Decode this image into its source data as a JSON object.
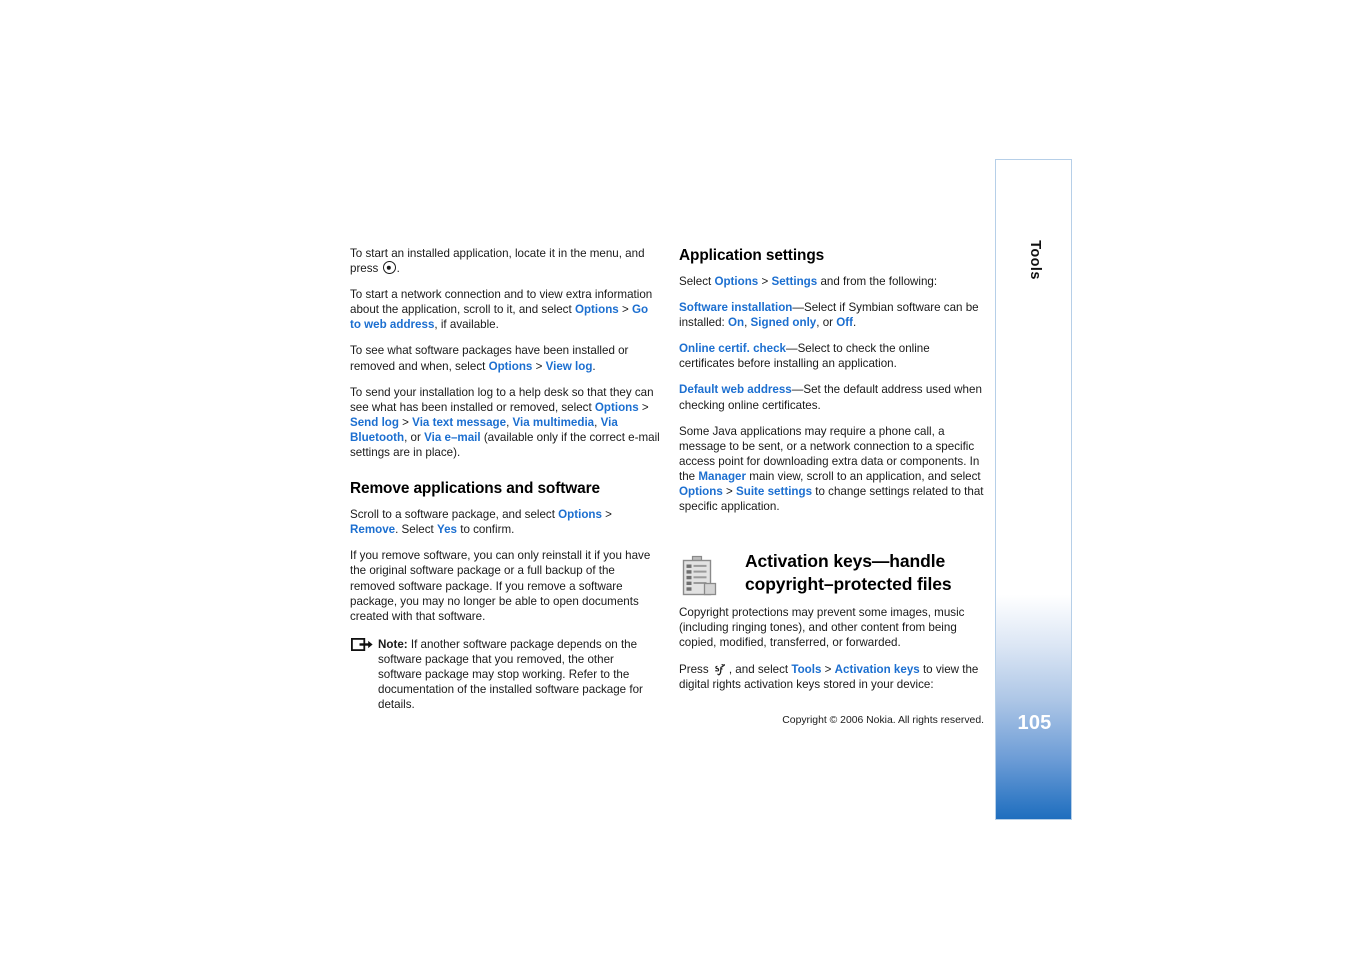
{
  "document": {
    "title": "Nokia device user guide page",
    "page_number": "105",
    "section_tab_label": "Tools",
    "copyright": "Copyright © 2006 Nokia. All rights reserved."
  },
  "colors": {
    "link": "#1c6fd0",
    "tab_gradient_end": "#1f6ebe",
    "tab_border": "#b6cfe8",
    "text": "#1a1a1a"
  },
  "left_column": {
    "p1_a": "To start an installed application, locate it in the menu, and press ",
    "p1_b": ".",
    "p2_a": "To start a network connection and to view extra information about the application, scroll to it, and select ",
    "p2_link1": "Options",
    "p2_sep": " > ",
    "p2_link2": "Go to web address",
    "p2_b": ", if available.",
    "p3_a": "To see what software packages have been installed or removed and when, select ",
    "p3_link1": "Options",
    "p3_sep": " > ",
    "p3_link2": "View log",
    "p3_b": ".",
    "p4_a": "To send your installation log to a help desk so that they can see what has been installed or removed, select ",
    "p4_link1": "Options",
    "p4_sep1": " > ",
    "p4_link2": "Send log",
    "p4_sep2": " > ",
    "p4_link3": "Via text message",
    "p4_c1": ", ",
    "p4_link4": "Via multimedia",
    "p4_c2": ", ",
    "p4_link5": "Via Bluetooth",
    "p4_c3": ", or ",
    "p4_link6": "Via e–mail",
    "p4_b": " (available only if the correct e-mail settings are in place).",
    "heading": "Remove applications and software",
    "p5_a": "Scroll to a software package, and select ",
    "p5_link1": "Options",
    "p5_sep": " > ",
    "p5_link2": "Remove",
    "p5_mid": ". Select ",
    "p5_link3": "Yes",
    "p5_b": " to confirm.",
    "p6": "If you remove software, you can only reinstall it if you have the original software package or a full backup of the removed software package. If you remove a software package, you may no longer be able to open documents created with that software.",
    "note_label": "Note:",
    "note_body": " If another software package depends on the software package that you removed, the other software package may stop working. Refer to the documentation of the installed software package for details."
  },
  "right_column": {
    "heading1": "Application settings",
    "r1_a": "Select ",
    "r1_link1": "Options",
    "r1_sep": " > ",
    "r1_link2": "Settings",
    "r1_b": " and from the following:",
    "r2_link1": "Software installation",
    "r2_a": "—Select if Symbian software can be installed: ",
    "r2_link2": "On",
    "r2_c1": ", ",
    "r2_link3": "Signed only",
    "r2_c2": ", or ",
    "r2_link4": "Off",
    "r2_b": ".",
    "r3_link1": "Online certif. check",
    "r3_a": "—Select to check the online certificates before installing an application.",
    "r4_link1": "Default web address",
    "r4_a": "—Set the default address used when checking online certificates.",
    "r5_a": "Some Java applications may require a phone call, a message to be sent, or a network connection to a specific access point for downloading extra data or components. In the ",
    "r5_link1": "Manager",
    "r5_b": " main view, scroll to an application, and select ",
    "r5_link2": "Options",
    "r5_sep": " > ",
    "r5_link3": "Suite settings",
    "r5_c": " to change settings related to that specific application.",
    "heading2_line1": "Activation keys—handle",
    "heading2_line2": "copyright–protected files",
    "r6": "Copyright protections may prevent some images, music (including ringing tones), and other content from being copied, modified, transferred, or forwarded.",
    "r7_a": "Press ",
    "r7_b": ", and select ",
    "r7_link1": "Tools",
    "r7_sep": " > ",
    "r7_link2": "Activation keys",
    "r7_c": " to view the digital rights activation keys stored in your device:"
  }
}
